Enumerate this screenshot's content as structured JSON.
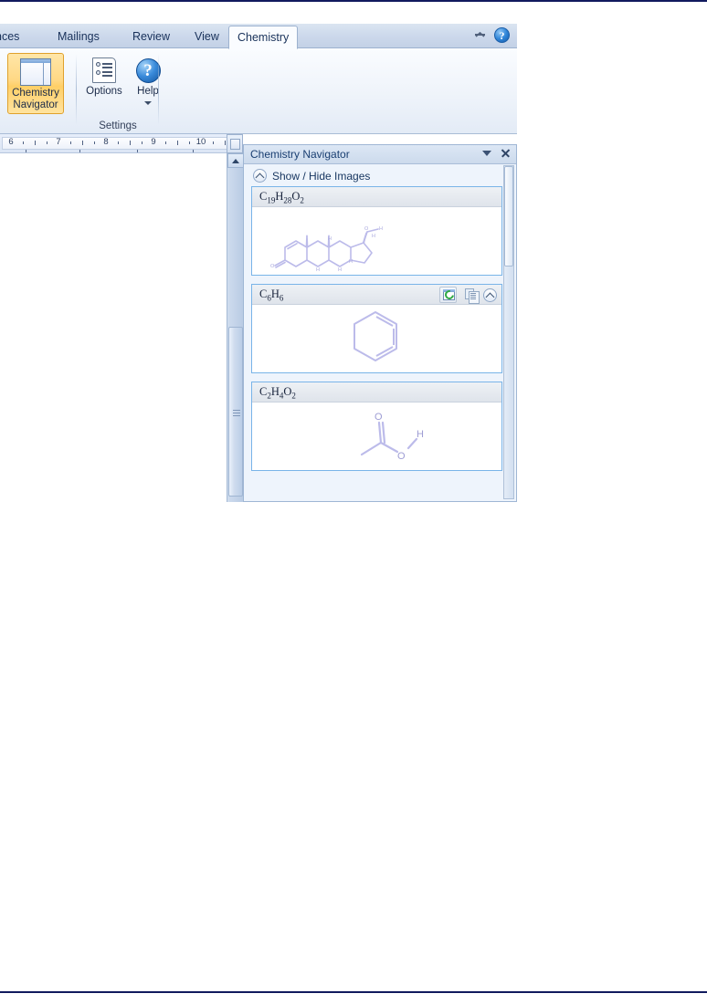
{
  "ribbon": {
    "tabs": [
      {
        "label": "nces",
        "active": false
      },
      {
        "label": "Mailings",
        "active": false
      },
      {
        "label": "Review",
        "active": false
      },
      {
        "label": "View",
        "active": false
      },
      {
        "label": "Chemistry",
        "active": true
      }
    ],
    "collapse_icon": "chevron-up-icon",
    "help_icon": "help-icon",
    "help_glyph": "?",
    "groups": [
      {
        "name": "chemistry-navigator",
        "label": "",
        "buttons": [
          {
            "label": "Chemistry\nNavigator",
            "line1": "Chemistry",
            "line2": "Navigator",
            "selected": true,
            "icon": "window-pane-icon"
          }
        ]
      },
      {
        "name": "settings",
        "label": "Settings",
        "buttons": [
          {
            "line1": "Options",
            "line2": "",
            "selected": false,
            "icon": "options-document-icon"
          },
          {
            "line1": "Help",
            "line2": "",
            "selected": false,
            "icon": "help-icon",
            "glyph": "?",
            "has_dropdown": true
          }
        ]
      }
    ]
  },
  "ruler": {
    "ticks": [
      "6",
      "7",
      "8",
      "9",
      "10"
    ],
    "minor_marks": 8
  },
  "pane": {
    "title": "Chemistry Navigator",
    "dropdown_icon": "caret-down-icon",
    "close_icon": "close-icon",
    "show_hide": {
      "label": "Show / Hide Images",
      "toggle_icon": "chevron-up-circle-icon"
    },
    "cards": [
      {
        "formula_html": "C<sub>19</sub>H<sub>28</sub>O<sub>2</sub>",
        "formula_text": "C19H28O2",
        "structure": "steroid-testosterone-structure",
        "tools_visible": false,
        "selected": false
      },
      {
        "formula_html": "C<sub>6</sub>H<sub>6</sub>",
        "formula_text": "C6H6",
        "structure": "benzene-ring-structure",
        "tools_visible": true,
        "selected": false,
        "tools": [
          {
            "name": "insert-structure-icon",
            "enabled": true
          },
          {
            "name": "copy-icon",
            "enabled": false
          },
          {
            "name": "collapse-icon",
            "enabled": true
          }
        ]
      },
      {
        "formula_html": "C<sub>2</sub>H<sub>4</sub>O<sub>2</sub>",
        "formula_text": "C2H4O2",
        "structure": "acetic-acid-structure",
        "tools_visible": false,
        "selected": false,
        "atom_labels": [
          "O",
          "O",
          "H"
        ]
      }
    ]
  },
  "colors": {
    "accent_blue": "#79b4e8",
    "selected_gold": "#ffd884",
    "structure_purple": "#b9b8e8",
    "page_rule": "#111a5e"
  }
}
